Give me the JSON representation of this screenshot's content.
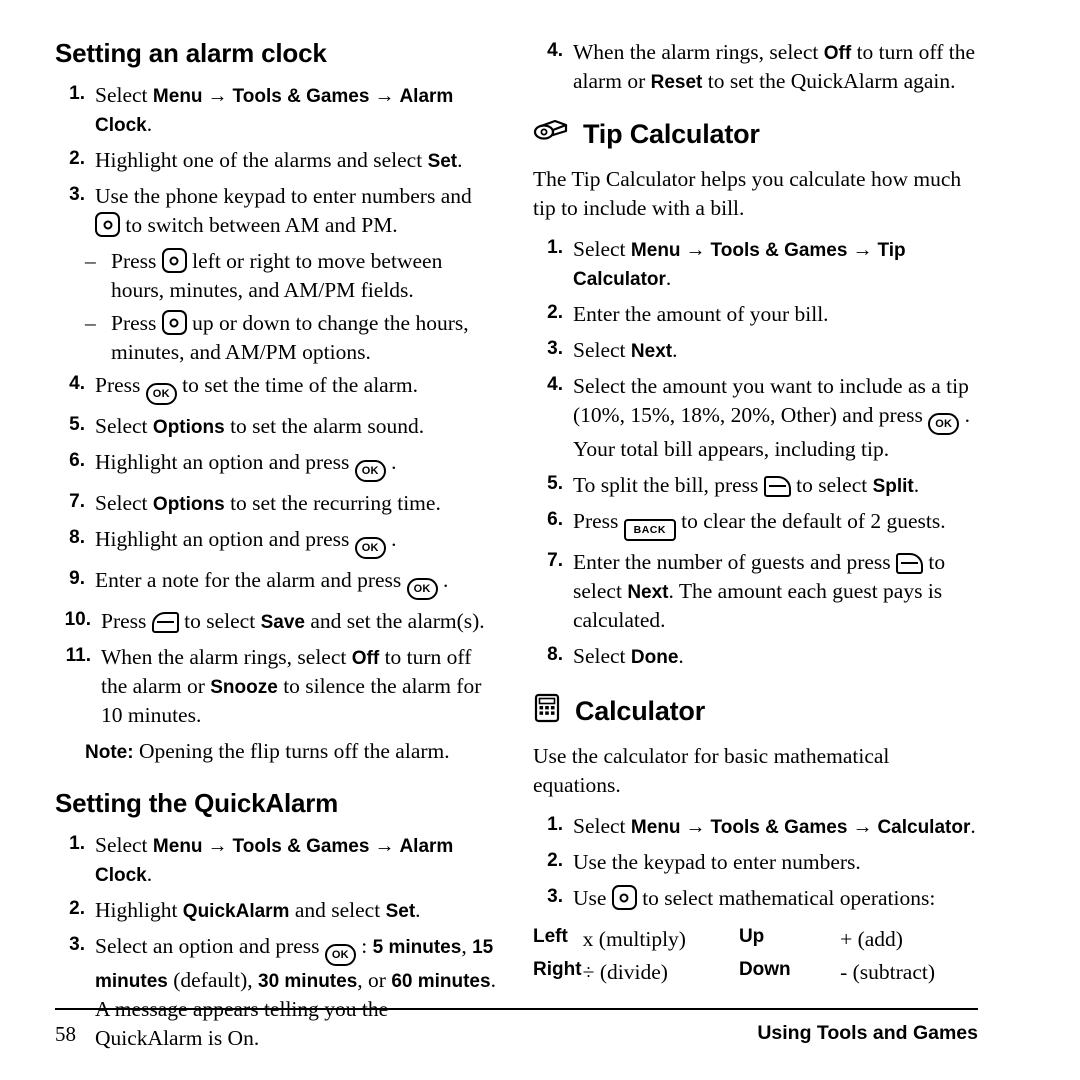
{
  "page": {
    "number": "58",
    "footer_right": "Using Tools and Games"
  },
  "left_column": {
    "heading1": "Setting an alarm clock",
    "steps1": [
      {
        "num": "1.",
        "parts": [
          {
            "t": "Select ",
            "s": "reg"
          },
          {
            "t": "Menu",
            "s": "bold"
          },
          {
            "t": " → ",
            "s": "arrow"
          },
          {
            "t": "Tools & Games",
            "s": "bold"
          },
          {
            "t": " → ",
            "s": "arrow"
          },
          {
            "t": "Alarm Clock",
            "s": "bold"
          },
          {
            "t": ".",
            "s": "reg"
          }
        ]
      },
      {
        "num": "2.",
        "parts": [
          {
            "t": "Highlight one of the alarms and select ",
            "s": "reg"
          },
          {
            "t": "Set",
            "s": "bold"
          },
          {
            "t": ".",
            "s": "reg"
          }
        ]
      },
      {
        "num": "3.",
        "parts": [
          {
            "t": "Use the phone keypad to enter numbers and ",
            "s": "reg"
          },
          {
            "t": "",
            "s": "nav-key"
          },
          {
            "t": " to switch between AM and PM.",
            "s": "reg"
          }
        ]
      }
    ],
    "sub_items": [
      {
        "dash": "–",
        "parts": [
          {
            "t": "Press ",
            "s": "reg"
          },
          {
            "t": "",
            "s": "nav-key"
          },
          {
            "t": " left or right to move between hours, minutes, and AM/PM fields.",
            "s": "reg"
          }
        ]
      },
      {
        "dash": "–",
        "parts": [
          {
            "t": "Press ",
            "s": "reg"
          },
          {
            "t": "",
            "s": "nav-key"
          },
          {
            "t": " up or down to change the hours, minutes, and AM/PM options.",
            "s": "reg"
          }
        ]
      }
    ],
    "steps2": [
      {
        "num": "4.",
        "parts": [
          {
            "t": "Press ",
            "s": "reg"
          },
          {
            "t": "OK",
            "s": "ok-key"
          },
          {
            "t": " to set the time of the alarm.",
            "s": "reg"
          }
        ]
      },
      {
        "num": "5.",
        "parts": [
          {
            "t": "Select ",
            "s": "reg"
          },
          {
            "t": "Options",
            "s": "bold"
          },
          {
            "t": " to set the alarm sound.",
            "s": "reg"
          }
        ]
      },
      {
        "num": "6.",
        "parts": [
          {
            "t": "Highlight an option and press ",
            "s": "reg"
          },
          {
            "t": "OK",
            "s": "ok-key"
          },
          {
            "t": " .",
            "s": "reg"
          }
        ]
      },
      {
        "num": "7.",
        "parts": [
          {
            "t": "Select ",
            "s": "reg"
          },
          {
            "t": "Options",
            "s": "bold"
          },
          {
            "t": " to set the recurring time.",
            "s": "reg"
          }
        ]
      },
      {
        "num": "8.",
        "parts": [
          {
            "t": "Highlight an option and press ",
            "s": "reg"
          },
          {
            "t": "OK",
            "s": "ok-key"
          },
          {
            "t": " .",
            "s": "reg"
          }
        ]
      },
      {
        "num": "9.",
        "parts": [
          {
            "t": "Enter a note for the alarm and press ",
            "s": "reg"
          },
          {
            "t": "OK",
            "s": "ok-key"
          },
          {
            "t": " .",
            "s": "reg"
          }
        ]
      },
      {
        "num": "10.",
        "parts": [
          {
            "t": "Press ",
            "s": "reg"
          },
          {
            "t": "",
            "s": "left-soft-key"
          },
          {
            "t": " to select ",
            "s": "reg"
          },
          {
            "t": "Save",
            "s": "bold"
          },
          {
            "t": " and set the alarm(s).",
            "s": "reg"
          }
        ]
      },
      {
        "num": "11.",
        "parts": [
          {
            "t": "When the alarm rings, select ",
            "s": "reg"
          },
          {
            "t": "Off",
            "s": "bold"
          },
          {
            "t": " to turn off the alarm or ",
            "s": "reg"
          },
          {
            "t": "Snooze",
            "s": "bold"
          },
          {
            "t": " to silence the alarm for 10 minutes.",
            "s": "reg"
          }
        ]
      }
    ],
    "note": [
      {
        "t": "Note:",
        "s": "bold"
      },
      {
        "t": "  Opening the flip turns off the alarm.",
        "s": "reg"
      }
    ],
    "heading2": "Setting the QuickAlarm",
    "steps3": [
      {
        "num": "1.",
        "parts": [
          {
            "t": "Select ",
            "s": "reg"
          },
          {
            "t": "Menu",
            "s": "bold"
          },
          {
            "t": " → ",
            "s": "arrow"
          },
          {
            "t": "Tools & Games",
            "s": "bold"
          },
          {
            "t": " → ",
            "s": "arrow"
          },
          {
            "t": "Alarm Clock",
            "s": "bold"
          },
          {
            "t": ".",
            "s": "reg"
          }
        ]
      },
      {
        "num": "2.",
        "parts": [
          {
            "t": "Highlight ",
            "s": "reg"
          },
          {
            "t": "QuickAlarm",
            "s": "bold"
          },
          {
            "t": " and select ",
            "s": "reg"
          },
          {
            "t": "Set",
            "s": "bold"
          },
          {
            "t": ".",
            "s": "reg"
          }
        ]
      },
      {
        "num": "3.",
        "parts": [
          {
            "t": "Select an option and press ",
            "s": "reg"
          },
          {
            "t": "OK",
            "s": "ok-key"
          },
          {
            "t": " : ",
            "s": "reg"
          },
          {
            "t": "5 minutes",
            "s": "bold"
          },
          {
            "t": ", ",
            "s": "reg"
          },
          {
            "t": "15 minutes",
            "s": "bold"
          },
          {
            "t": " (default), ",
            "s": "reg"
          },
          {
            "t": "30 minutes",
            "s": "bold"
          },
          {
            "t": ", or ",
            "s": "reg"
          },
          {
            "t": "60 minutes",
            "s": "bold"
          },
          {
            "t": ". A message appears telling you the QuickAlarm is On.",
            "s": "reg"
          }
        ]
      }
    ]
  },
  "right_column": {
    "steps_cont": [
      {
        "num": "4.",
        "parts": [
          {
            "t": "When the alarm rings, select ",
            "s": "reg"
          },
          {
            "t": "Off",
            "s": "bold"
          },
          {
            "t": " to turn off the alarm or ",
            "s": "reg"
          },
          {
            "t": "Reset",
            "s": "bold"
          },
          {
            "t": " to set the QuickAlarm again.",
            "s": "reg"
          }
        ]
      }
    ],
    "heading_tip": "Tip Calculator",
    "tip_intro": "The Tip Calculator helps you calculate how much tip to include with a bill.",
    "tip_steps": [
      {
        "num": "1.",
        "parts": [
          {
            "t": "Select ",
            "s": "reg"
          },
          {
            "t": "Menu",
            "s": "bold"
          },
          {
            "t": " → ",
            "s": "arrow"
          },
          {
            "t": "Tools & Games",
            "s": "bold"
          },
          {
            "t": " → ",
            "s": "arrow"
          },
          {
            "t": "Tip Calculator",
            "s": "bold"
          },
          {
            "t": ".",
            "s": "reg"
          }
        ]
      },
      {
        "num": "2.",
        "parts": [
          {
            "t": "Enter the amount of your bill.",
            "s": "reg"
          }
        ]
      },
      {
        "num": "3.",
        "parts": [
          {
            "t": "Select ",
            "s": "reg"
          },
          {
            "t": "Next",
            "s": "bold"
          },
          {
            "t": ".",
            "s": "reg"
          }
        ]
      },
      {
        "num": "4.",
        "parts": [
          {
            "t": "Select the amount you want to include as a tip (10%, 15%, 18%, 20%, Other) and press ",
            "s": "reg"
          },
          {
            "t": "OK",
            "s": "ok-key"
          },
          {
            "t": " . Your total bill appears, including tip.",
            "s": "reg"
          }
        ]
      },
      {
        "num": "5.",
        "parts": [
          {
            "t": "To split the bill, press ",
            "s": "reg"
          },
          {
            "t": "",
            "s": "right-soft-key"
          },
          {
            "t": " to select ",
            "s": "reg"
          },
          {
            "t": "Split",
            "s": "bold"
          },
          {
            "t": ".",
            "s": "reg"
          }
        ]
      },
      {
        "num": "6.",
        "parts": [
          {
            "t": "Press ",
            "s": "reg"
          },
          {
            "t": "BACK",
            "s": "back-key"
          },
          {
            "t": " to clear the default of 2 guests.",
            "s": "reg"
          }
        ]
      },
      {
        "num": "7.",
        "parts": [
          {
            "t": "Enter the number of guests and press ",
            "s": "reg"
          },
          {
            "t": "",
            "s": "right-soft-key"
          },
          {
            "t": " to select ",
            "s": "reg"
          },
          {
            "t": "Next",
            "s": "bold"
          },
          {
            "t": ". The amount each guest pays is calculated.",
            "s": "reg"
          }
        ]
      },
      {
        "num": "8.",
        "parts": [
          {
            "t": "Select ",
            "s": "reg"
          },
          {
            "t": "Done",
            "s": "bold"
          },
          {
            "t": ".",
            "s": "reg"
          }
        ]
      }
    ],
    "heading_calc": "Calculator",
    "calc_intro": "Use the calculator for basic mathematical equations.",
    "calc_steps": [
      {
        "num": "1.",
        "parts": [
          {
            "t": "Select ",
            "s": "reg"
          },
          {
            "t": "Menu",
            "s": "bold"
          },
          {
            "t": " → ",
            "s": "arrow"
          },
          {
            "t": "Tools & Games",
            "s": "bold"
          },
          {
            "t": " → ",
            "s": "arrow"
          },
          {
            "t": "Calculator",
            "s": "bold"
          },
          {
            "t": ".",
            "s": "reg"
          }
        ]
      },
      {
        "num": "2.",
        "parts": [
          {
            "t": "Use the keypad to enter numbers.",
            "s": "reg"
          }
        ]
      },
      {
        "num": "3.",
        "parts": [
          {
            "t": "Use ",
            "s": "reg"
          },
          {
            "t": "",
            "s": "nav-key"
          },
          {
            "t": " to select mathematical operations:",
            "s": "reg"
          }
        ]
      }
    ],
    "key_table": [
      {
        "k1": "Left",
        "v1": "x (multiply)",
        "k2": "Up",
        "v2": "+ (add)"
      },
      {
        "k1": "Right",
        "v1": "÷ (divide)",
        "k2": "Down",
        "v2": "- (subtract)"
      }
    ]
  },
  "icons": {
    "tip_calculator": "tip-calculator-icon",
    "calculator": "calculator-icon",
    "nav_key": "navigation-key-icon",
    "ok_key": "ok-key-icon",
    "left_soft_key": "left-softkey-icon",
    "right_soft_key": "right-softkey-icon",
    "back_key": "back-key-icon"
  }
}
